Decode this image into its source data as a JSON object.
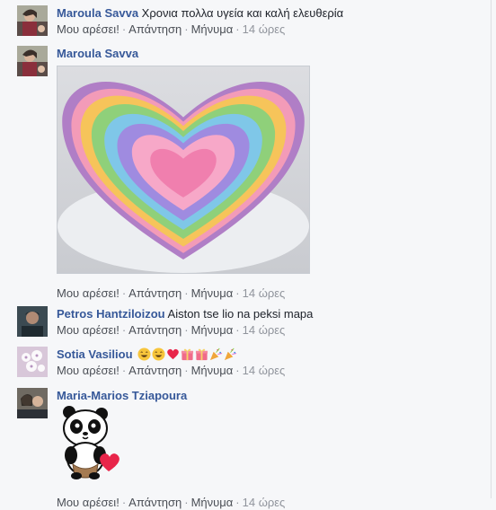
{
  "comments": [
    {
      "author": "Maroula Savva",
      "text": "Χρονια πολλα υγεία και καλή ελευθερία",
      "actions": {
        "like": "Μου αρέσει!",
        "reply": "Απάντηση",
        "message": "Μήνυμα",
        "time": "14 ώρες"
      }
    },
    {
      "author": "Maroula Savva",
      "text": "",
      "attachment": "heart-shaped-rainbow-cake-photo",
      "actions": {
        "like": "Μου αρέσει!",
        "reply": "Απάντηση",
        "message": "Μήνυμα",
        "time": "14 ώρες"
      }
    },
    {
      "author": "Petros Hantziloizou",
      "text": "Aiston tse lio na peksi mapa",
      "actions": {
        "like": "Μου αρέσει!",
        "reply": "Απάντηση",
        "message": "Μήνυμα",
        "time": "14 ώρες"
      }
    },
    {
      "author": "Sotia Vasiliou",
      "text": "",
      "emojis": [
        "grinning-face",
        "grinning-face",
        "red-heart",
        "gift",
        "gift",
        "party-popper",
        "party-popper"
      ],
      "actions": {
        "like": "Μου αρέσει!",
        "reply": "Απάντηση",
        "message": "Μήνυμα",
        "time": "14 ώρες"
      }
    },
    {
      "author": "Maria-Marios Tziapoura",
      "text": "",
      "attachment": "panda-with-heart-sticker",
      "actions": {
        "like": "Μου αρέσει!",
        "reply": "Απάντηση",
        "message": "Μήνυμα",
        "time": "14 ώρες"
      }
    }
  ],
  "colors": {
    "author": "#365899",
    "link": "#4b4f56",
    "meta": "#90949c",
    "background": "#f6f7f9"
  }
}
